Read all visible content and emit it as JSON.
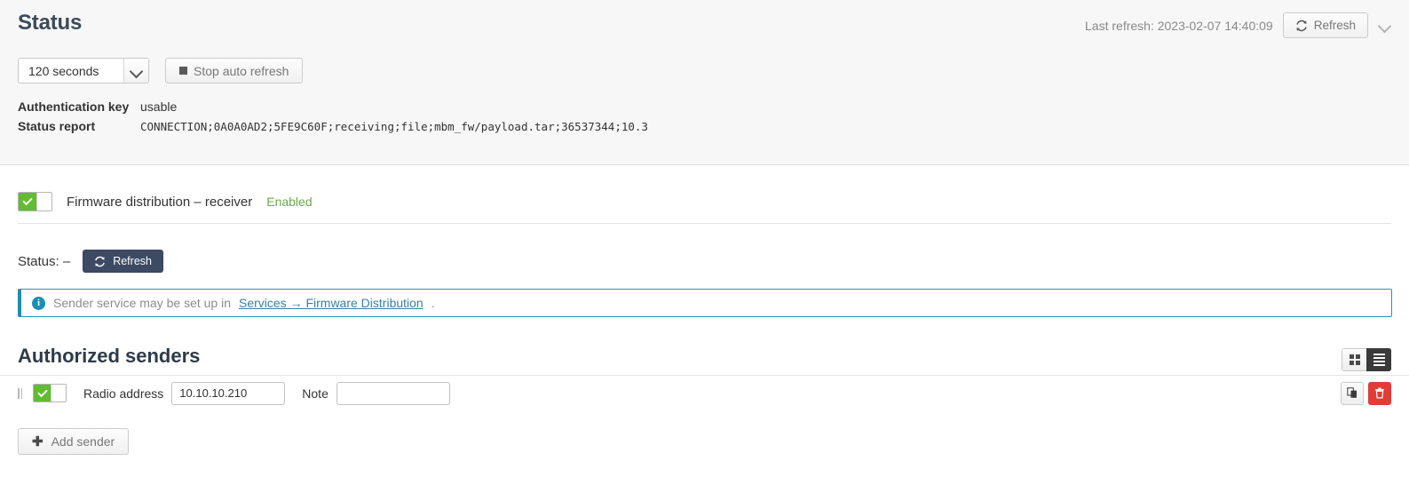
{
  "header": {
    "title": "Status",
    "last_refresh_label": "Last refresh: 2023-02-07 14:40:09",
    "refresh_button_label": "Refresh",
    "collapse_icon": "chevron-down-icon"
  },
  "controls": {
    "interval_value": "120 seconds",
    "interval_options": [
      "120 seconds"
    ],
    "stop_auto_refresh_label": "Stop auto refresh"
  },
  "status_info": {
    "auth_key_label": "Authentication key",
    "auth_key_value": "usable",
    "status_report_label": "Status report",
    "status_report_value": "CONNECTION;0A0A0AD2;5FE9C60F;receiving;file;mbm_fw/payload.tar;36537344;10.3"
  },
  "feature": {
    "toggle_label": "Firmware distribution – receiver",
    "toggle_state": "Enabled",
    "toggle_on": true
  },
  "service": {
    "status_label": "Status: –",
    "refresh_button_label": "Refresh"
  },
  "alert": {
    "icon": "info-circle-icon",
    "text_before": "Sender service may be set up in",
    "link_text": "Services → Firmware Distribution",
    "text_after": "."
  },
  "senders": {
    "heading": "Authorized senders",
    "view_modes": {
      "grid_label": "grid-view",
      "list_label": "list-view",
      "active": "list-view"
    },
    "rows": [
      {
        "enabled": true,
        "radio_address_label": "Radio address",
        "radio_address_value": "10.10.10.210",
        "note_label": "Note",
        "note_value": "",
        "note_placeholder": ""
      }
    ],
    "add_button_label": "Add sender"
  },
  "colors": {
    "accent_green": "#62bb32",
    "enabled_text": "#6aa84f",
    "alert_border": "#2196b5",
    "danger": "#e23c35",
    "dark_button": "#3c4a63",
    "heading": "#3d4a5c"
  }
}
